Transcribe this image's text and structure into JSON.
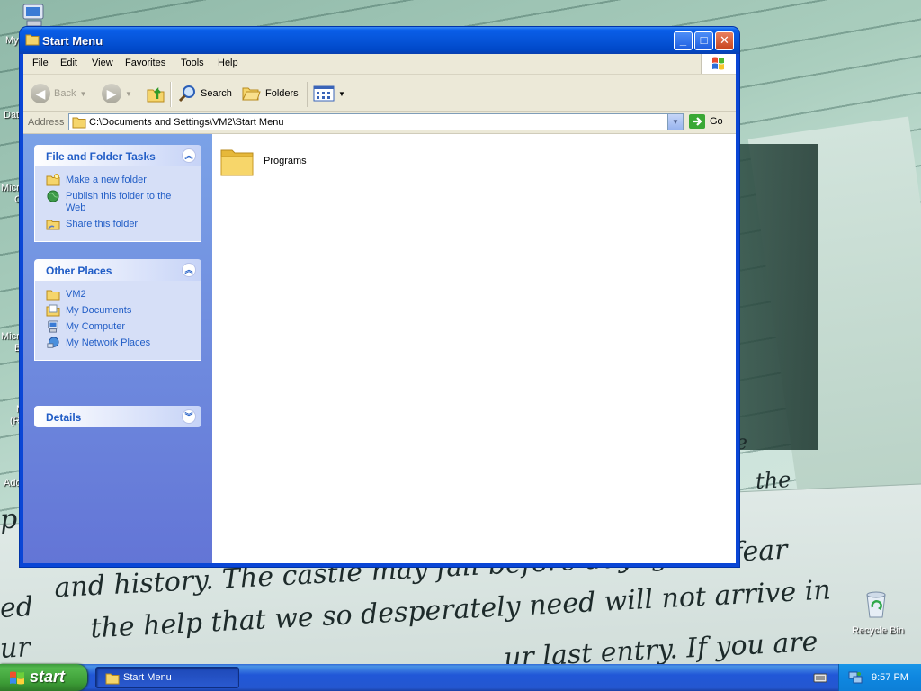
{
  "desktop": {
    "icons": [
      {
        "label": "My",
        "name": "my-computer"
      },
      {
        "label": "Dat",
        "name": "data"
      },
      {
        "label": "Micro",
        "name": "microsoft-1"
      },
      {
        "label": "C",
        "name": "microsoft-1-b"
      },
      {
        "label": "Micro",
        "name": "microsoft-2"
      },
      {
        "label": "B",
        "name": "microsoft-2-b"
      },
      {
        "label": "N",
        "name": "n-icon"
      },
      {
        "label": "(R",
        "name": "r-icon"
      },
      {
        "label": "Ado",
        "name": "adobe"
      }
    ],
    "recycle_bin_label": "Recycle Bin",
    "handwriting": {
      "line1": "and history. The castle may fall before daylight, I fear",
      "line2": "the help that we so desperately need will not arrive in",
      "line3": "ur last entry. If you are",
      "line4": "the",
      "frag1": "ed",
      "frag2": "ur",
      "frag3": "p",
      "frag4": "ve",
      "frag5": "e"
    }
  },
  "window": {
    "title": "Start Menu",
    "controls": {
      "minimize": "_",
      "maximize": "□",
      "close": "✕"
    },
    "menu": [
      "File",
      "Edit",
      "View",
      "Favorites",
      "Tools",
      "Help"
    ],
    "toolbar": {
      "back": "Back",
      "search": "Search",
      "folders": "Folders"
    },
    "address": {
      "label": "Address",
      "value": "C:\\Documents and Settings\\VM2\\Start Menu",
      "go": "Go"
    },
    "tasks": {
      "file_folder": {
        "title": "File and Folder Tasks",
        "items": [
          "Make a new folder",
          "Publish this folder to the Web",
          "Share this folder"
        ]
      },
      "other_places": {
        "title": "Other Places",
        "items": [
          "VM2",
          "My Documents",
          "My Computer",
          "My Network Places"
        ]
      },
      "details": {
        "title": "Details"
      }
    },
    "content": {
      "items": [
        {
          "label": "Programs",
          "type": "folder"
        }
      ]
    }
  },
  "taskbar": {
    "start_label": "start",
    "task_buttons": [
      "Start Menu"
    ],
    "clock": "9:57 PM"
  },
  "colors": {
    "title_bar": "#0a5ee8",
    "task_pane": "#7ba2e7",
    "task_link": "#215dc6",
    "start_button": "#3c9c36",
    "taskbar": "#2457d0",
    "tray": "#0f87e0"
  }
}
